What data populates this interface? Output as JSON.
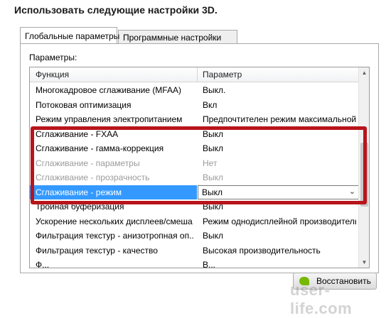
{
  "heading": "Использовать следующие настройки 3D.",
  "tabs": [
    {
      "label": "Глобальные параметры",
      "active": true
    },
    {
      "label": "Программные настройки",
      "active": false
    }
  ],
  "params_label": "Параметры:",
  "grid": {
    "columns": [
      "Функция",
      "Параметр"
    ],
    "rows": [
      {
        "feature": "Многокадровое сглаживание (MFAA)",
        "value": "Выкл.",
        "state": "normal"
      },
      {
        "feature": "Потоковая оптимизация",
        "value": "Вкл",
        "state": "normal"
      },
      {
        "feature": "Режим управления электропитанием",
        "value": "Предпочтителен режим максимальной п...",
        "state": "normal"
      },
      {
        "feature": "Сглаживание - FXAA",
        "value": "Выкл",
        "state": "normal"
      },
      {
        "feature": "Сглаживание - гамма-коррекция",
        "value": "Выкл",
        "state": "normal"
      },
      {
        "feature": "Сглаживание - параметры",
        "value": "Нет",
        "state": "disabled"
      },
      {
        "feature": "Сглаживание - прозрачность",
        "value": "Выкл",
        "state": "disabled"
      },
      {
        "feature": "Сглаживание - режим",
        "value": "Выкл",
        "state": "selected"
      },
      {
        "feature": "Тройная буферизация",
        "value": "Выкл",
        "state": "normal"
      },
      {
        "feature": "Ускорение нескольких дисплеев/смеша...",
        "value": "Режим однодисплейной производитель...",
        "state": "normal"
      },
      {
        "feature": "Фильтрация текстур - анизотропная оп...",
        "value": "Выкл",
        "state": "normal"
      },
      {
        "feature": "Фильтрация текстур - качество",
        "value": "Высокая производительность",
        "state": "normal"
      },
      {
        "feature": "Ф...",
        "value": "В...",
        "state": "normal"
      }
    ]
  },
  "restore_button": "Восстановить",
  "watermark": "user-life.com",
  "colors": {
    "highlight": "#b8141b",
    "selection": "#3399ff",
    "nvidia": "#76b900"
  }
}
